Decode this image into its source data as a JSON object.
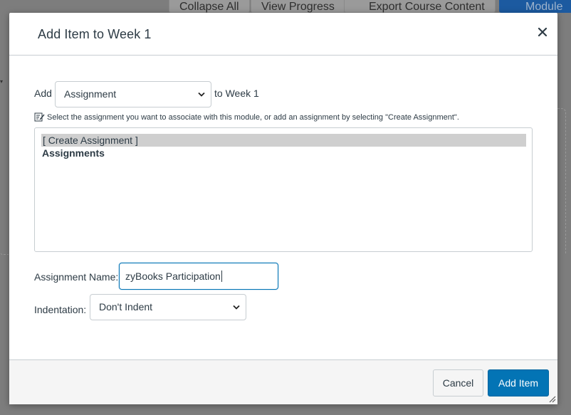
{
  "background": {
    "toolbar": {
      "collapse_all": "Collapse All",
      "view_progress": "View Progress",
      "export_course_content": "Export Course Content",
      "module": "Module"
    }
  },
  "dialog": {
    "title": "Add Item to Week 1",
    "add_label": "Add",
    "item_type": {
      "selected": "Assignment"
    },
    "to_week_label": "to Week 1",
    "hint": "Select the assignment you want to associate with this module, or add an assignment by selecting \"Create Assignment\".",
    "list": {
      "selected_option": "[ Create Assignment ]",
      "group_label": "Assignments"
    },
    "assignment_name": {
      "label": "Assignment Name:",
      "value": "zyBooks Participation"
    },
    "indentation": {
      "label": "Indentation:",
      "selected": "Don't Indent"
    },
    "footer": {
      "cancel": "Cancel",
      "add_item": "Add Item"
    }
  },
  "colors": {
    "primary": "#0374b5",
    "text": "#2d3b45",
    "border": "#c7cdd1",
    "overlay": "#7d7d7d"
  }
}
